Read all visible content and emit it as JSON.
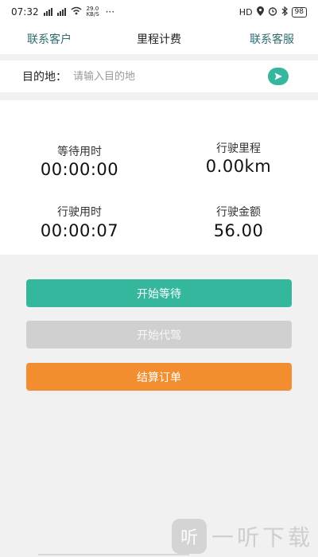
{
  "status_bar": {
    "time": "07:32",
    "net_speed": "29.0 KB/S",
    "more": "···",
    "hd": "HD",
    "battery": "98"
  },
  "header": {
    "left_link": "联系客户",
    "title": "里程计费",
    "right_link": "联系客服"
  },
  "destination": {
    "label": "目的地：",
    "placeholder": "请输入目的地",
    "value": ""
  },
  "stats": {
    "wait_time_label": "等待用时",
    "wait_time_value": "00:00:00",
    "distance_label": "行驶里程",
    "distance_value": "0.00km",
    "drive_time_label": "行驶用时",
    "drive_time_value": "00:00:07",
    "amount_label": "行驶金额",
    "amount_value": "56.00"
  },
  "buttons": {
    "start_wait": "开始等待",
    "start_drive": "开始代驾",
    "settle_order": "结算订单"
  },
  "colors": {
    "accent_green": "#35b79d",
    "link_teal": "#2d6c73",
    "disabled_grey": "#d0d0d0",
    "orange": "#f28e2f"
  },
  "watermark": {
    "logo_text": "听",
    "text": "一听下载"
  }
}
